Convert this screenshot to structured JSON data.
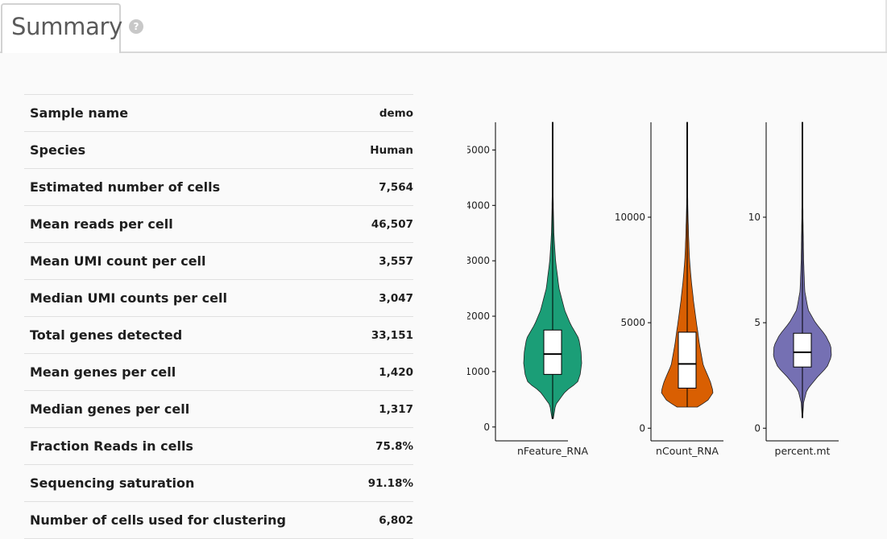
{
  "header": {
    "tab_title": "Summary",
    "help_icon": "question-circle-icon",
    "help_glyph": "?"
  },
  "summary": {
    "rows": [
      {
        "label": "Sample name",
        "value": "demo"
      },
      {
        "label": "Species",
        "value": "Human"
      },
      {
        "label": "Estimated number of cells",
        "value": "7,564"
      },
      {
        "label": "Mean reads per cell",
        "value": "46,507"
      },
      {
        "label": "Mean UMI count per cell",
        "value": "3,557"
      },
      {
        "label": "Median UMI counts per cell",
        "value": "3,047"
      },
      {
        "label": "Total genes detected",
        "value": "33,151"
      },
      {
        "label": "Mean genes per cell",
        "value": "1,420"
      },
      {
        "label": "Median genes per cell",
        "value": "1,317"
      },
      {
        "label": "Fraction Reads in cells",
        "value": "75.8%"
      },
      {
        "label": "Sequencing saturation",
        "value": "91.18%"
      },
      {
        "label": "Number of cells used for clustering",
        "value": "6,802"
      }
    ]
  },
  "chart_data": [
    {
      "type": "violin",
      "xlabel": "nFeature_RNA",
      "color": "#1b9e77",
      "ylim": [
        -250,
        5500
      ],
      "ticks": [
        0,
        1000,
        2000,
        3000,
        4000,
        5000
      ],
      "range": [
        150,
        5500
      ],
      "box": {
        "q1": 950,
        "median": 1317,
        "q3": 1750
      },
      "density": [
        [
          150,
          0.02
        ],
        [
          400,
          0.1
        ],
        [
          650,
          0.45
        ],
        [
          800,
          0.85
        ],
        [
          950,
          0.95
        ],
        [
          1150,
          1.0
        ],
        [
          1350,
          0.98
        ],
        [
          1600,
          0.9
        ],
        [
          1850,
          0.62
        ],
        [
          2100,
          0.42
        ],
        [
          2500,
          0.22
        ],
        [
          3000,
          0.1
        ],
        [
          3500,
          0.04
        ],
        [
          4200,
          0.015
        ],
        [
          5500,
          0.005
        ]
      ]
    },
    {
      "type": "violin",
      "xlabel": "nCount_RNA",
      "color": "#d95f02",
      "ylim": [
        -600,
        14500
      ],
      "ticks": [
        0,
        5000,
        10000
      ],
      "range": [
        1000,
        14500
      ],
      "box": {
        "q1": 1900,
        "median": 3047,
        "q3": 4550
      },
      "density": [
        [
          1000,
          0.35
        ],
        [
          1300,
          0.7
        ],
        [
          1700,
          0.9
        ],
        [
          2200,
          0.8
        ],
        [
          3000,
          0.55
        ],
        [
          4000,
          0.42
        ],
        [
          5000,
          0.32
        ],
        [
          6000,
          0.22
        ],
        [
          7000,
          0.14
        ],
        [
          8000,
          0.08
        ],
        [
          9000,
          0.05
        ],
        [
          10500,
          0.02
        ],
        [
          12000,
          0.01
        ],
        [
          14500,
          0.004
        ]
      ]
    },
    {
      "type": "violin",
      "xlabel": "percent.mt",
      "color": "#7570b3",
      "ylim": [
        -0.6,
        14.5
      ],
      "ticks": [
        0,
        5,
        10
      ],
      "range": [
        0.5,
        14.5
      ],
      "box": {
        "q1": 2.9,
        "median": 3.6,
        "q3": 4.5
      },
      "density": [
        [
          0.5,
          0.01
        ],
        [
          1.2,
          0.04
        ],
        [
          1.8,
          0.15
        ],
        [
          2.4,
          0.5
        ],
        [
          2.9,
          0.85
        ],
        [
          3.4,
          1.0
        ],
        [
          3.9,
          0.98
        ],
        [
          4.4,
          0.8
        ],
        [
          5.0,
          0.45
        ],
        [
          5.6,
          0.2
        ],
        [
          6.5,
          0.08
        ],
        [
          8,
          0.04
        ],
        [
          10,
          0.02
        ],
        [
          12,
          0.01
        ],
        [
          14.5,
          0.005
        ]
      ]
    }
  ]
}
